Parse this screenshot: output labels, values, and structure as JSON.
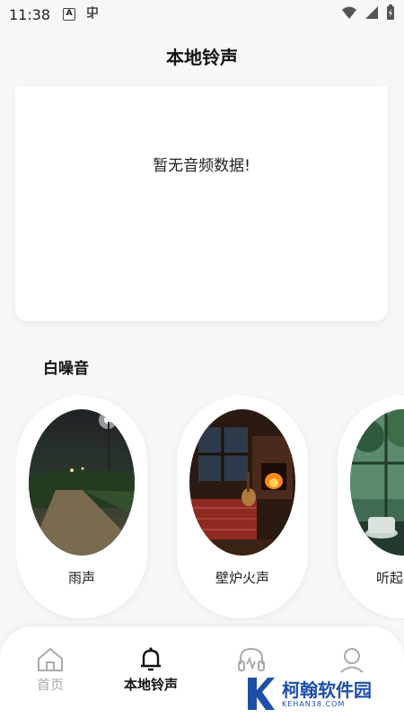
{
  "status_bar": {
    "time": "11:38",
    "icons": [
      "a-badge-icon",
      "app-notification-icon",
      "wifi-icon",
      "signal-icon",
      "battery-icon"
    ]
  },
  "header": {
    "title": "本地铃声"
  },
  "audio_list": {
    "empty_text": "暂无音频数据!"
  },
  "white_noise": {
    "title": "白噪音",
    "items": [
      {
        "label": "雨声"
      },
      {
        "label": "壁炉火声"
      },
      {
        "label": "听起来放"
      }
    ]
  },
  "tab_bar": {
    "items": [
      {
        "label": "首页",
        "icon": "home-icon",
        "active": false
      },
      {
        "label": "本地铃声",
        "icon": "bell-icon",
        "active": true
      },
      {
        "label": "",
        "icon": "headphones-icon",
        "active": false
      },
      {
        "label": "",
        "icon": "user-icon",
        "active": false
      }
    ]
  },
  "watermark": {
    "main": "柯翰软件园",
    "sub": "KEHAN38.COM"
  },
  "colors": {
    "accent": "#111111",
    "inactive": "#aaaaaa",
    "watermark": "#1d4fa8",
    "background": "#f7f7f7"
  }
}
